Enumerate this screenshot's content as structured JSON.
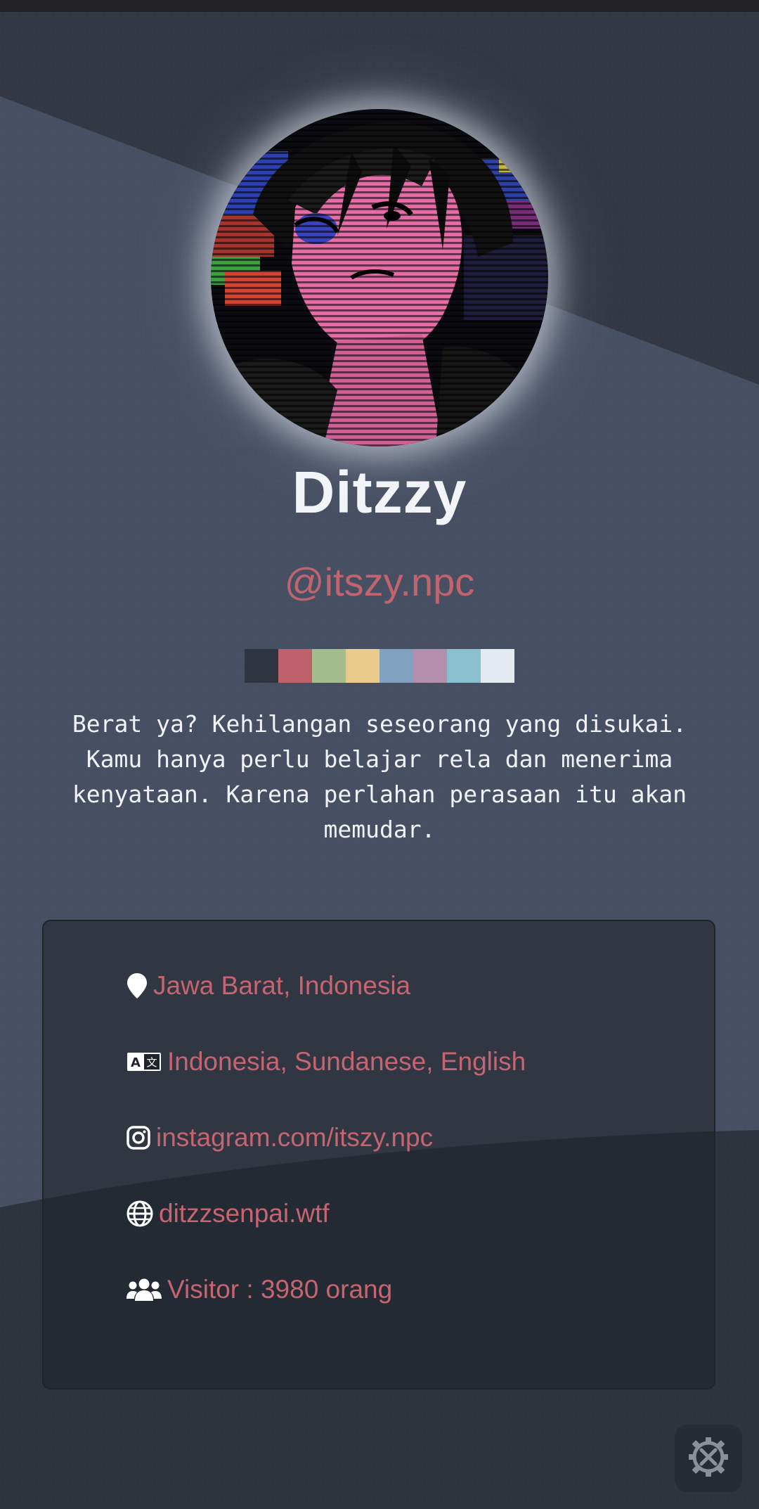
{
  "profile": {
    "name": "Ditzzy",
    "handle": "@itszy.npc",
    "bio": "Berat ya? Kehilangan seseorang yang disukai. Kamu hanya perlu belajar rela dan menerima kenyataan. Karena perlahan perasaan itu akan memudar."
  },
  "palette": [
    "#2e3440",
    "#bf616a",
    "#a3be8c",
    "#ebcb8b",
    "#81a1c1",
    "#b48ead",
    "#88c0d0",
    "#e5e9f0"
  ],
  "info": {
    "location": "Jawa Barat, Indonesia",
    "languages": "Indonesia, Sundanese, English",
    "instagram": "instagram.com/itszy.npc",
    "website": "ditzzsenpai.wtf",
    "visitors": "Visitor : 3980 orang"
  },
  "icons": {
    "location": "map-pin-icon",
    "languages": "language-icon",
    "instagram": "instagram-icon",
    "website": "globe-icon",
    "visitors": "users-icon",
    "fab": "settings-tools-icon"
  },
  "colors": {
    "accent": "#c1646f",
    "background": "#3a4150",
    "card": "#272b33",
    "text": "#f2f4f8"
  }
}
